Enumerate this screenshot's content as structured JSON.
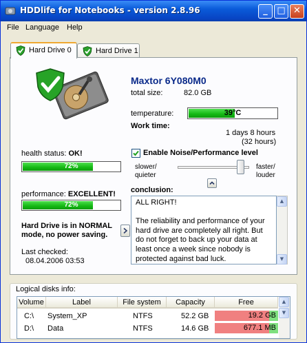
{
  "window": {
    "title": "HDDlife for Notebooks - version 2.8.96",
    "controls": [
      "_",
      "□",
      "✕"
    ]
  },
  "menu": [
    "File",
    "Language",
    "Help"
  ],
  "tabs": [
    {
      "label": "Hard Drive 0"
    },
    {
      "label": "Hard Drive 1"
    }
  ],
  "drive": {
    "model": "Maxtor 6Y080M0",
    "total_size_label": "total size:",
    "total_size": "82.0 GB",
    "temperature_label": "temperature:",
    "temperature": "39°C",
    "work_time_label": "Work time:",
    "work_time": "1 days 8 hours",
    "work_time_hours": "(32 hours)",
    "health_label": "health status:",
    "health_value": "OK!",
    "health_percent": "72%",
    "health_level": 0.72,
    "performance_label": "performance:",
    "performance_value": "EXCELLENT!",
    "performance_percent": "72%",
    "performance_level": 0.72,
    "mode_text_1": "Hard Drive is in NORMAL",
    "mode_text_2": "mode, no power saving.",
    "last_checked_label": "Last checked:",
    "last_checked": "08.04.2006 03:53"
  },
  "noise": {
    "label": "Enable Noise/Performance level",
    "checked": true,
    "left_label_1": "slower/",
    "left_label_2": "quieter",
    "right_label_1": "faster/",
    "right_label_2": "louder",
    "level": 1.0
  },
  "conclusion": {
    "label": "conclusion:",
    "line_1": "ALL RIGHT!",
    "line_2": "The reliability and performance of your hard drive are completely all right. But do not forget to back up your data at least once a week since nobody is protected against bad luck."
  },
  "logical": {
    "title": "Logical disks info:",
    "columns": [
      "Volume",
      "Label",
      "File system",
      "Capacity",
      "Free"
    ],
    "rows": [
      {
        "volume": "C:\\",
        "label": "System_XP",
        "fs": "NTFS",
        "capacity": "52.2 GB",
        "free": "19.2 GB",
        "free_fraction": 0.37
      },
      {
        "volume": "D:\\",
        "label": "Data",
        "fs": "NTFS",
        "capacity": "14.6 GB",
        "free": "677.1 MB",
        "free_fraction": 0.05
      }
    ]
  },
  "colors": {
    "title_bar": "#0a5bd9",
    "progress_green": "#13b813",
    "free_low": "#f08080",
    "free_ok": "#7fe07f",
    "model_blue": "#0a2a8a"
  }
}
